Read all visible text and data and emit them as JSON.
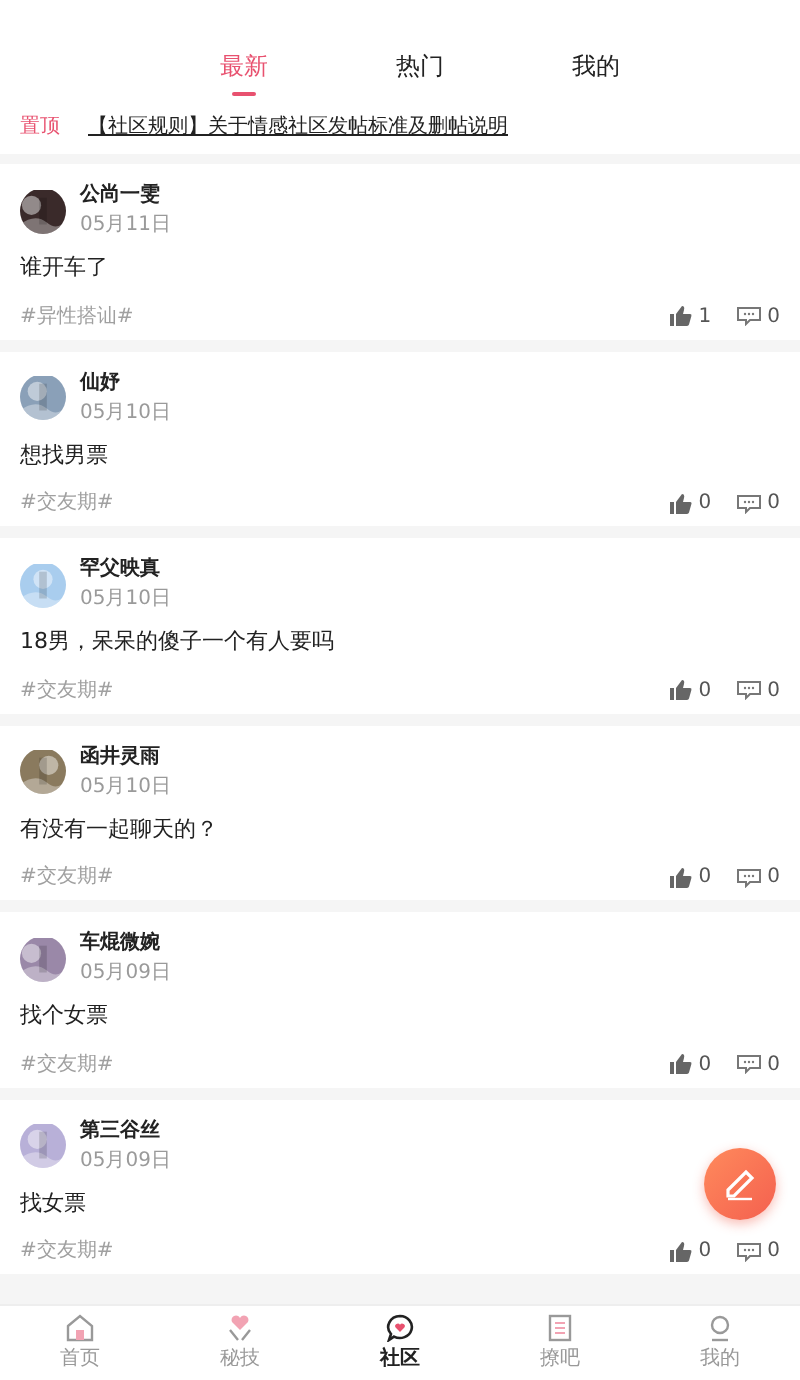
{
  "tabs": [
    {
      "label": "最新",
      "selected": true
    },
    {
      "label": "热门",
      "selected": false
    },
    {
      "label": "我的",
      "selected": false
    }
  ],
  "pinned": {
    "badge": "置顶",
    "title": "【社区规则】关于情感社区发帖标准及删帖说明"
  },
  "posts": [
    {
      "author": "公尚一雯",
      "date": "05月11日",
      "content": "谁开车了",
      "tag": "#异性搭讪#",
      "likes": "1",
      "comments": "0"
    },
    {
      "author": "仙妤",
      "date": "05月10日",
      "content": "想找男票",
      "tag": "#交友期#",
      "likes": "0",
      "comments": "0"
    },
    {
      "author": "罕父映真",
      "date": "05月10日",
      "content": "18男，呆呆的傻子一个有人要吗",
      "tag": "#交友期#",
      "likes": "0",
      "comments": "0"
    },
    {
      "author": "函井灵雨",
      "date": "05月10日",
      "content": "有没有一起聊天的？",
      "tag": "#交友期#",
      "likes": "0",
      "comments": "0"
    },
    {
      "author": "车焜微婉",
      "date": "05月09日",
      "content": "找个女票",
      "tag": "#交友期#",
      "likes": "0",
      "comments": "0"
    },
    {
      "author": "第三谷丝",
      "date": "05月09日",
      "content": "找女票",
      "tag": "#交友期#",
      "likes": "0",
      "comments": "0"
    }
  ],
  "bottom_nav": [
    {
      "label": "首页",
      "selected": false
    },
    {
      "label": "秘技",
      "selected": false
    },
    {
      "label": "社区",
      "selected": true
    },
    {
      "label": "撩吧",
      "selected": false
    },
    {
      "label": "我的",
      "selected": false
    }
  ]
}
